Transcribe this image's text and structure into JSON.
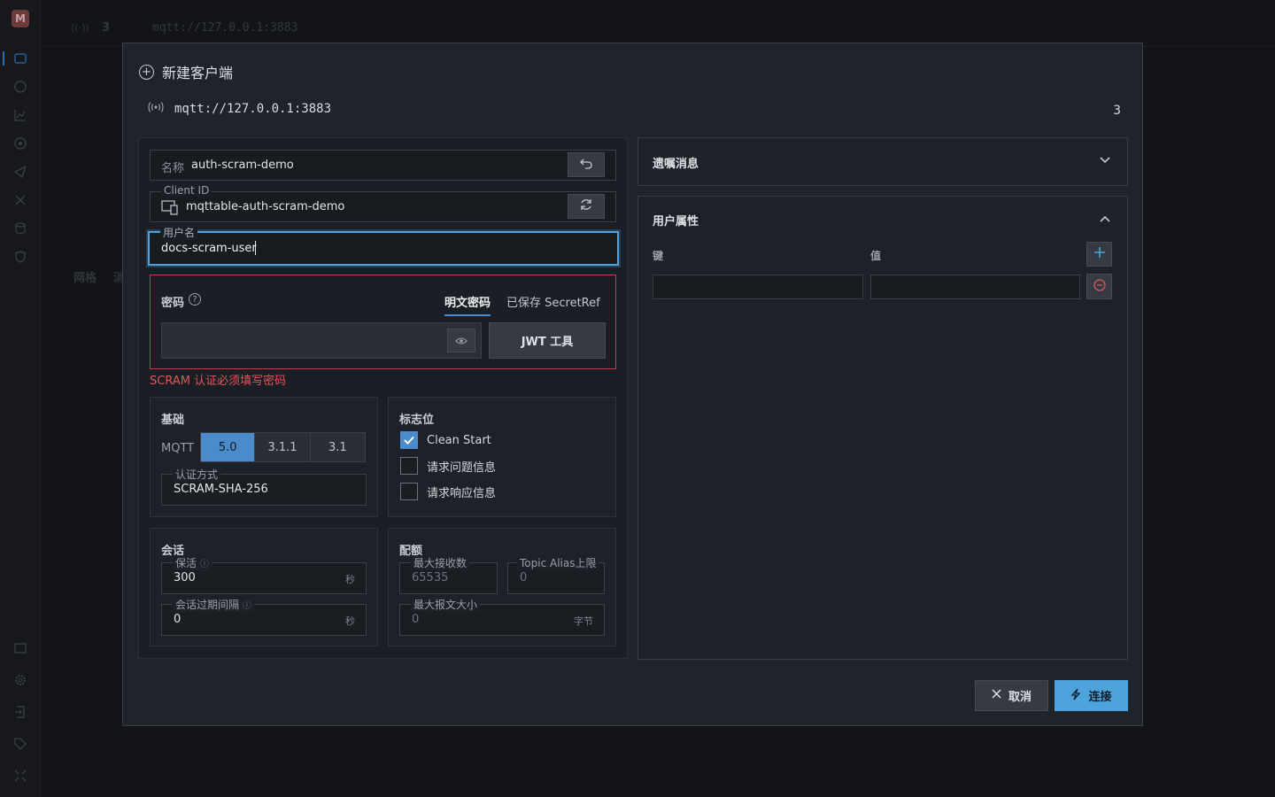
{
  "app": {
    "logo": "M",
    "topbar_badge": "((·))",
    "topbar_count": "3",
    "topbar_url": "mqtt://127.0.0.1:3883",
    "bg_tab": "网格",
    "bg_tab2": "消"
  },
  "modal": {
    "title": "新建客户端",
    "url": "mqtt://127.0.0.1:3883",
    "count": "3",
    "name": {
      "label": "名称",
      "value": "auth-scram-demo"
    },
    "client_id": {
      "label": "Client ID",
      "value": "mqttable-auth-scram-demo"
    },
    "username": {
      "label": "用户名",
      "value": "docs-scram-user"
    },
    "password": {
      "label": "密码",
      "tab_plain": "明文密码",
      "tab_saved": "已保存 SecretRef",
      "value": "",
      "jwt_button": "JWT 工具",
      "error": "SCRAM 认证必须填写密码"
    },
    "basic": {
      "title": "基础",
      "mqtt_label": "MQTT",
      "versions": [
        "5.0",
        "3.1.1",
        "3.1"
      ],
      "selected_version": "5.0",
      "auth_label": "认证方式",
      "auth_value": "SCRAM-SHA-256"
    },
    "flags": {
      "title": "标志位",
      "items": [
        {
          "label": "Clean Start",
          "checked": true
        },
        {
          "label": "请求问题信息",
          "checked": false
        },
        {
          "label": "请求响应信息",
          "checked": false
        }
      ]
    },
    "session": {
      "title": "会话",
      "keepalive_label": "保活",
      "keepalive_value": "300",
      "keepalive_unit": "秒",
      "expiry_label": "会话过期间隔",
      "expiry_value": "0",
      "expiry_unit": "秒"
    },
    "quota": {
      "title": "配额",
      "receive_max_label": "最大接收数",
      "receive_max_placeholder": "65535",
      "topic_alias_label": "Topic Alias上限",
      "topic_alias_placeholder": "0",
      "max_packet_label": "最大报文大小",
      "max_packet_placeholder": "0",
      "max_packet_unit": "字节"
    },
    "will": {
      "title": "遗嘱消息"
    },
    "user_props": {
      "title": "用户属性",
      "key_header": "键",
      "value_header": "值",
      "rows": [
        {
          "key": "",
          "value": ""
        }
      ]
    },
    "cancel_label": "取消",
    "connect_label": "连接"
  },
  "colors": {
    "accent": "#4b8bc9",
    "error": "#e0565b",
    "focus": "#4ea3dd"
  }
}
